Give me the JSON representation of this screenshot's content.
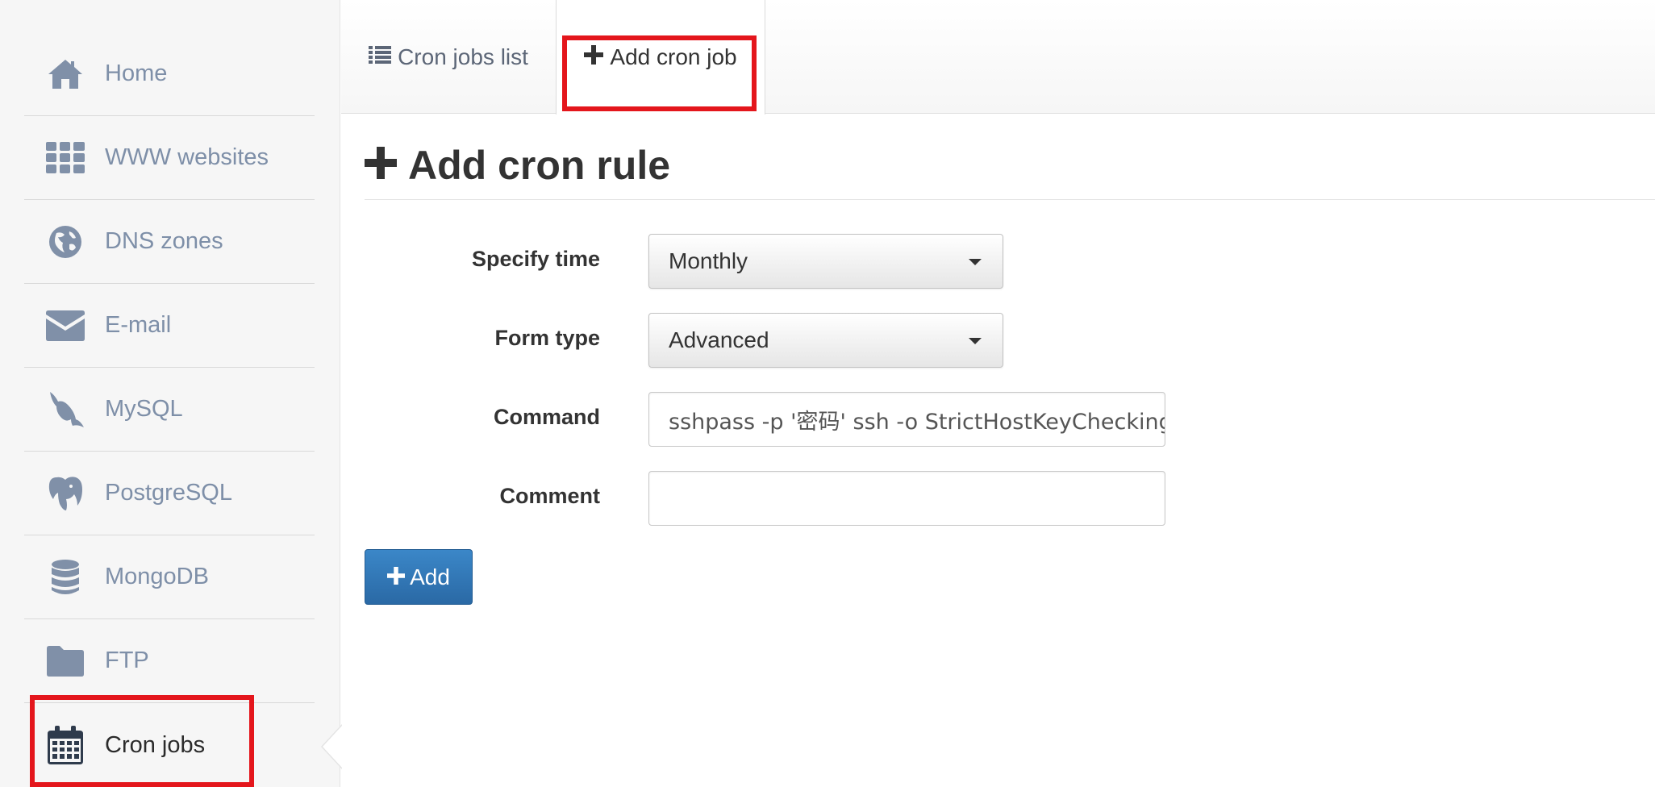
{
  "sidebar": {
    "items": [
      {
        "label": "Home",
        "icon": "home-icon"
      },
      {
        "label": "WWW websites",
        "icon": "grid-icon"
      },
      {
        "label": "DNS zones",
        "icon": "globe-icon"
      },
      {
        "label": "E-mail",
        "icon": "envelope-icon"
      },
      {
        "label": "MySQL",
        "icon": "dolphin-icon"
      },
      {
        "label": "PostgreSQL",
        "icon": "elephant-icon"
      },
      {
        "label": "MongoDB",
        "icon": "database-icon"
      },
      {
        "label": "FTP",
        "icon": "folder-icon"
      },
      {
        "label": "Cron jobs",
        "icon": "calendar-icon",
        "active": true
      }
    ]
  },
  "tabs": [
    {
      "label": "Cron jobs list",
      "icon": "list-icon"
    },
    {
      "label": "Add cron job",
      "icon": "plus-icon",
      "active": true
    }
  ],
  "main": {
    "title": "Add cron rule",
    "fields": {
      "specify_time": {
        "label": "Specify time",
        "value": "Monthly"
      },
      "form_type": {
        "label": "Form type",
        "value": "Advanced"
      },
      "command": {
        "label": "Command",
        "value": "sshpass -p '密码' ssh -o StrictHostKeyChecking"
      },
      "comment": {
        "label": "Comment",
        "value": ""
      }
    },
    "add_button": "Add"
  },
  "colors": {
    "highlight": "#e4161c",
    "primary_button": "#2f76b8",
    "sidebar_icon": "#8090a8"
  }
}
